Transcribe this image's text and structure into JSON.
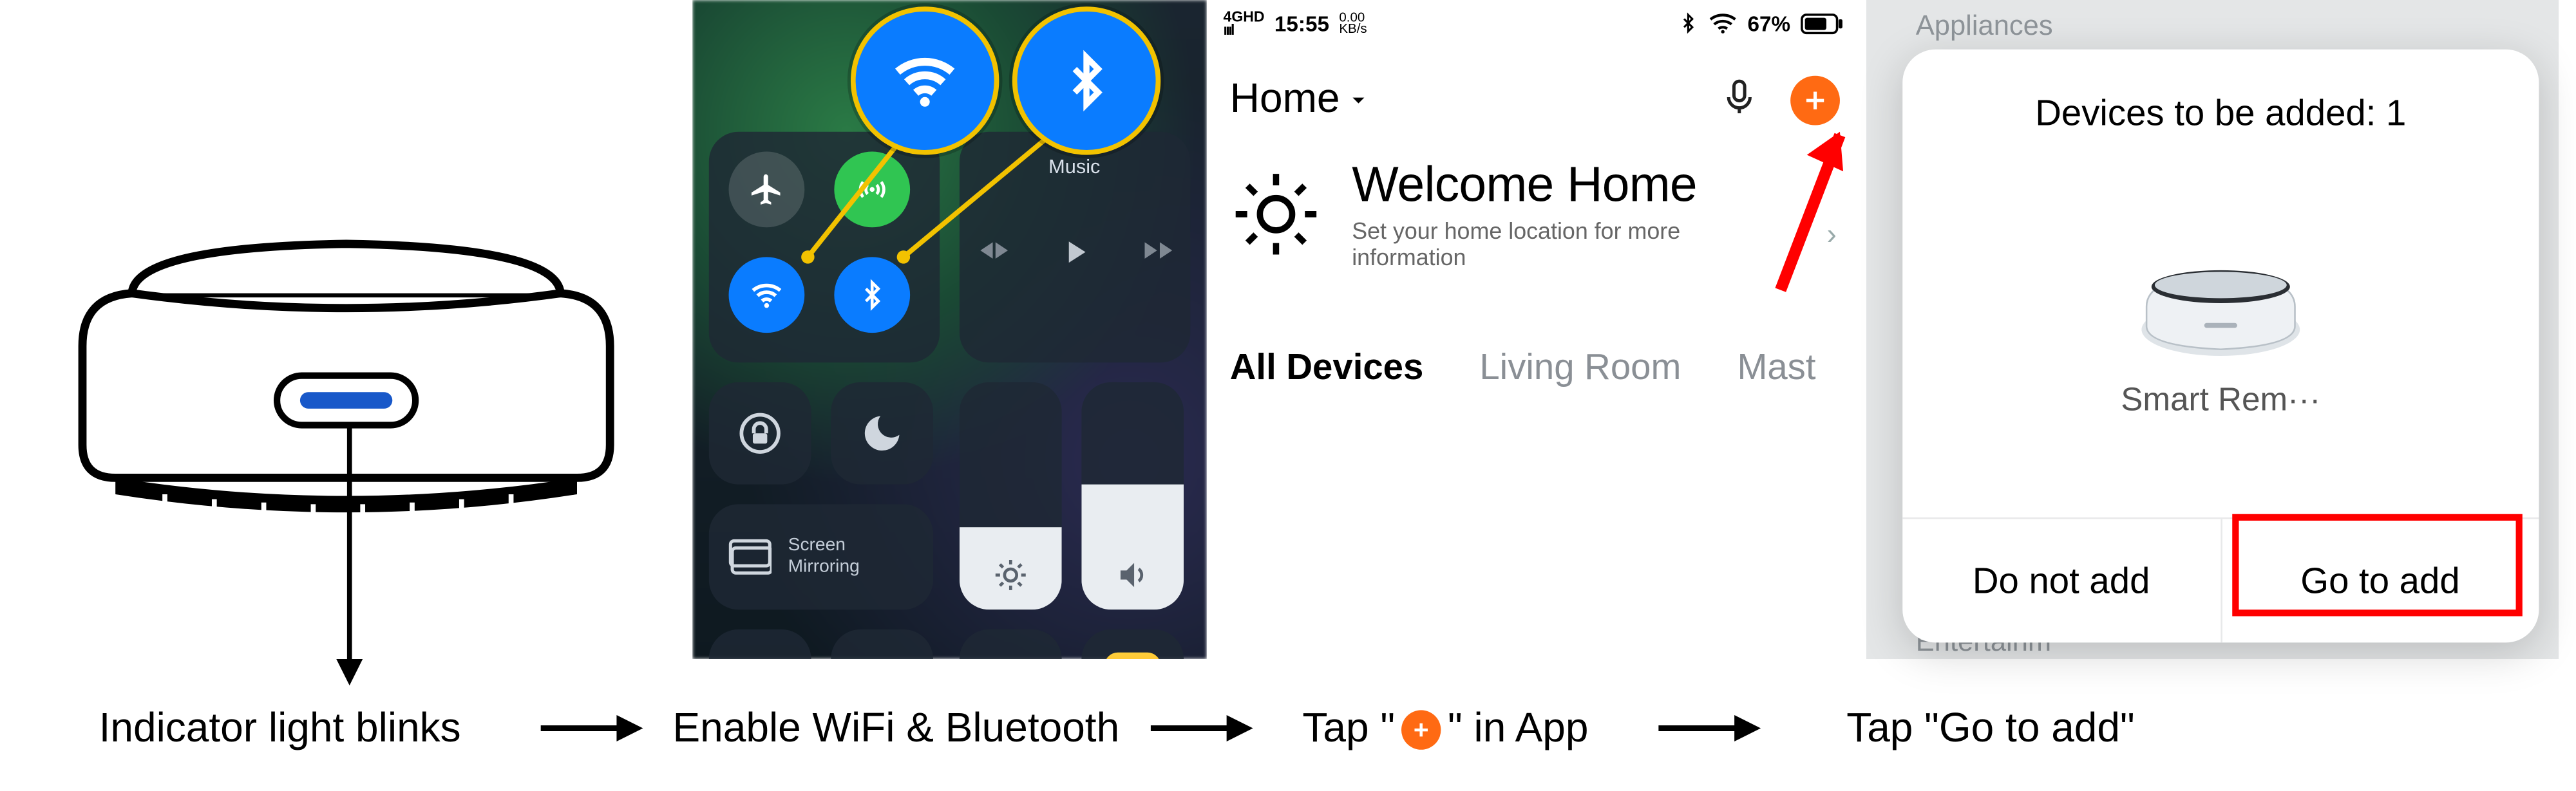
{
  "captions": {
    "step1": "Indicator light blinks",
    "step2": "Enable WiFi & Bluetooth",
    "step3_pre": "Tap \"",
    "step3_post": "\" in App",
    "step4": "Tap \"Go to add\""
  },
  "colors": {
    "accent_orange": "#ff6a13",
    "highlight_yellow": "#f2c200",
    "highlight_red": "#ff0000",
    "toggle_blue": "#0a7cff"
  },
  "step2": {
    "music_label": "Music",
    "screen_mirroring_label": "Screen\nMirroring"
  },
  "step3": {
    "status": {
      "network": "4G",
      "hd": "HD",
      "time": "15:55",
      "speed_top": "0.00",
      "speed_bottom": "KB/s",
      "battery": "67%"
    },
    "home_label": "Home",
    "welcome_title": "Welcome Home",
    "welcome_sub": "Set your home location for more information",
    "tabs": {
      "all": "All Devices",
      "living": "Living Room",
      "master_trunc": "Mast",
      "more": "···"
    }
  },
  "step4": {
    "bg_category": "Appliances",
    "bg_entertainment": "Entertainm",
    "popup_title": "Devices to be added: 1",
    "device_name": "Smart Rem···",
    "btn_no": "Do not add",
    "btn_go": "Go to add"
  }
}
